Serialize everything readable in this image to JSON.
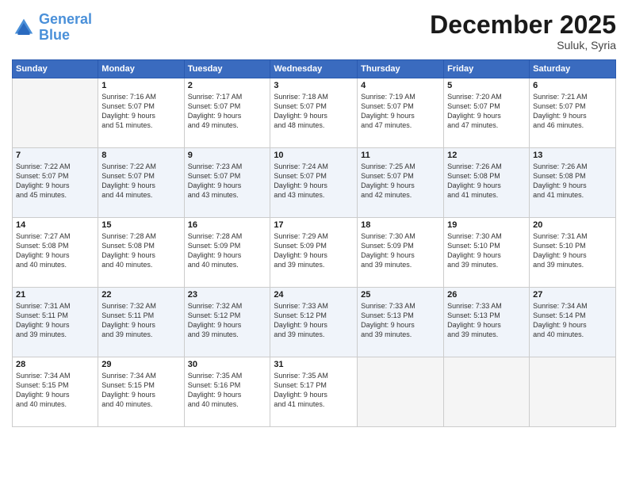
{
  "header": {
    "logo_line1": "General",
    "logo_line2": "Blue",
    "month": "December 2025",
    "location": "Suluk, Syria"
  },
  "days_of_week": [
    "Sunday",
    "Monday",
    "Tuesday",
    "Wednesday",
    "Thursday",
    "Friday",
    "Saturday"
  ],
  "weeks": [
    [
      {
        "day": "",
        "info": ""
      },
      {
        "day": "1",
        "info": "Sunrise: 7:16 AM\nSunset: 5:07 PM\nDaylight: 9 hours\nand 51 minutes."
      },
      {
        "day": "2",
        "info": "Sunrise: 7:17 AM\nSunset: 5:07 PM\nDaylight: 9 hours\nand 49 minutes."
      },
      {
        "day": "3",
        "info": "Sunrise: 7:18 AM\nSunset: 5:07 PM\nDaylight: 9 hours\nand 48 minutes."
      },
      {
        "day": "4",
        "info": "Sunrise: 7:19 AM\nSunset: 5:07 PM\nDaylight: 9 hours\nand 47 minutes."
      },
      {
        "day": "5",
        "info": "Sunrise: 7:20 AM\nSunset: 5:07 PM\nDaylight: 9 hours\nand 47 minutes."
      },
      {
        "day": "6",
        "info": "Sunrise: 7:21 AM\nSunset: 5:07 PM\nDaylight: 9 hours\nand 46 minutes."
      }
    ],
    [
      {
        "day": "7",
        "info": "Sunrise: 7:22 AM\nSunset: 5:07 PM\nDaylight: 9 hours\nand 45 minutes."
      },
      {
        "day": "8",
        "info": "Sunrise: 7:22 AM\nSunset: 5:07 PM\nDaylight: 9 hours\nand 44 minutes."
      },
      {
        "day": "9",
        "info": "Sunrise: 7:23 AM\nSunset: 5:07 PM\nDaylight: 9 hours\nand 43 minutes."
      },
      {
        "day": "10",
        "info": "Sunrise: 7:24 AM\nSunset: 5:07 PM\nDaylight: 9 hours\nand 43 minutes."
      },
      {
        "day": "11",
        "info": "Sunrise: 7:25 AM\nSunset: 5:07 PM\nDaylight: 9 hours\nand 42 minutes."
      },
      {
        "day": "12",
        "info": "Sunrise: 7:26 AM\nSunset: 5:08 PM\nDaylight: 9 hours\nand 41 minutes."
      },
      {
        "day": "13",
        "info": "Sunrise: 7:26 AM\nSunset: 5:08 PM\nDaylight: 9 hours\nand 41 minutes."
      }
    ],
    [
      {
        "day": "14",
        "info": "Sunrise: 7:27 AM\nSunset: 5:08 PM\nDaylight: 9 hours\nand 40 minutes."
      },
      {
        "day": "15",
        "info": "Sunrise: 7:28 AM\nSunset: 5:08 PM\nDaylight: 9 hours\nand 40 minutes."
      },
      {
        "day": "16",
        "info": "Sunrise: 7:28 AM\nSunset: 5:09 PM\nDaylight: 9 hours\nand 40 minutes."
      },
      {
        "day": "17",
        "info": "Sunrise: 7:29 AM\nSunset: 5:09 PM\nDaylight: 9 hours\nand 39 minutes."
      },
      {
        "day": "18",
        "info": "Sunrise: 7:30 AM\nSunset: 5:09 PM\nDaylight: 9 hours\nand 39 minutes."
      },
      {
        "day": "19",
        "info": "Sunrise: 7:30 AM\nSunset: 5:10 PM\nDaylight: 9 hours\nand 39 minutes."
      },
      {
        "day": "20",
        "info": "Sunrise: 7:31 AM\nSunset: 5:10 PM\nDaylight: 9 hours\nand 39 minutes."
      }
    ],
    [
      {
        "day": "21",
        "info": "Sunrise: 7:31 AM\nSunset: 5:11 PM\nDaylight: 9 hours\nand 39 minutes."
      },
      {
        "day": "22",
        "info": "Sunrise: 7:32 AM\nSunset: 5:11 PM\nDaylight: 9 hours\nand 39 minutes."
      },
      {
        "day": "23",
        "info": "Sunrise: 7:32 AM\nSunset: 5:12 PM\nDaylight: 9 hours\nand 39 minutes."
      },
      {
        "day": "24",
        "info": "Sunrise: 7:33 AM\nSunset: 5:12 PM\nDaylight: 9 hours\nand 39 minutes."
      },
      {
        "day": "25",
        "info": "Sunrise: 7:33 AM\nSunset: 5:13 PM\nDaylight: 9 hours\nand 39 minutes."
      },
      {
        "day": "26",
        "info": "Sunrise: 7:33 AM\nSunset: 5:13 PM\nDaylight: 9 hours\nand 39 minutes."
      },
      {
        "day": "27",
        "info": "Sunrise: 7:34 AM\nSunset: 5:14 PM\nDaylight: 9 hours\nand 40 minutes."
      }
    ],
    [
      {
        "day": "28",
        "info": "Sunrise: 7:34 AM\nSunset: 5:15 PM\nDaylight: 9 hours\nand 40 minutes."
      },
      {
        "day": "29",
        "info": "Sunrise: 7:34 AM\nSunset: 5:15 PM\nDaylight: 9 hours\nand 40 minutes."
      },
      {
        "day": "30",
        "info": "Sunrise: 7:35 AM\nSunset: 5:16 PM\nDaylight: 9 hours\nand 40 minutes."
      },
      {
        "day": "31",
        "info": "Sunrise: 7:35 AM\nSunset: 5:17 PM\nDaylight: 9 hours\nand 41 minutes."
      },
      {
        "day": "",
        "info": ""
      },
      {
        "day": "",
        "info": ""
      },
      {
        "day": "",
        "info": ""
      }
    ]
  ]
}
